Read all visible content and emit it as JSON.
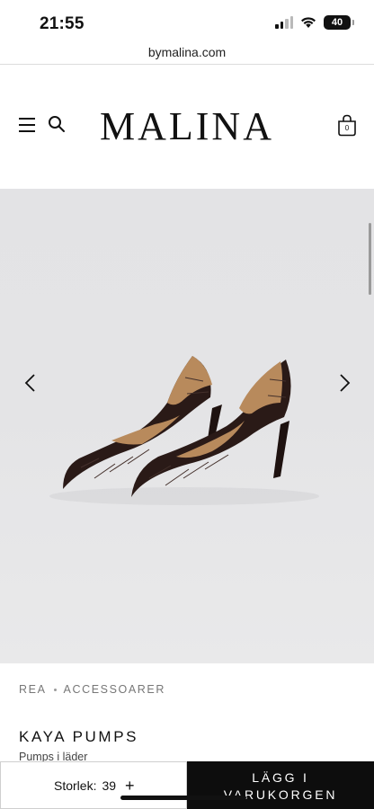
{
  "status_bar": {
    "time": "21:55",
    "battery": "40",
    "icons": [
      "signal-icon",
      "wifi-icon",
      "battery-icon"
    ]
  },
  "browser": {
    "url": "bymalina.com"
  },
  "header": {
    "logo": "MALINA",
    "cart_count": "0",
    "icons": [
      "menu-icon",
      "search-icon",
      "shopping-bag-icon"
    ]
  },
  "gallery": {
    "image_description_icon": "product-photo",
    "prev_icon": "chevron-left-icon",
    "next_icon": "chevron-right-icon"
  },
  "breadcrumb": {
    "items": [
      "REA",
      "ACCESSOARER"
    ]
  },
  "product": {
    "title": "KAYA PUMPS",
    "subtitle": "Pumps i läder"
  },
  "action_bar": {
    "size_label": "Storlek:",
    "size_value": "39",
    "size_plus": "+",
    "add_to_cart": "LÄGG I\nVARUKORGEN"
  },
  "colors": {
    "accent": "#0d0d0d",
    "gallery_background": "#e4e4e6",
    "shoe_leather": "#2a1a17",
    "shoe_lining": "#b88a5c"
  }
}
